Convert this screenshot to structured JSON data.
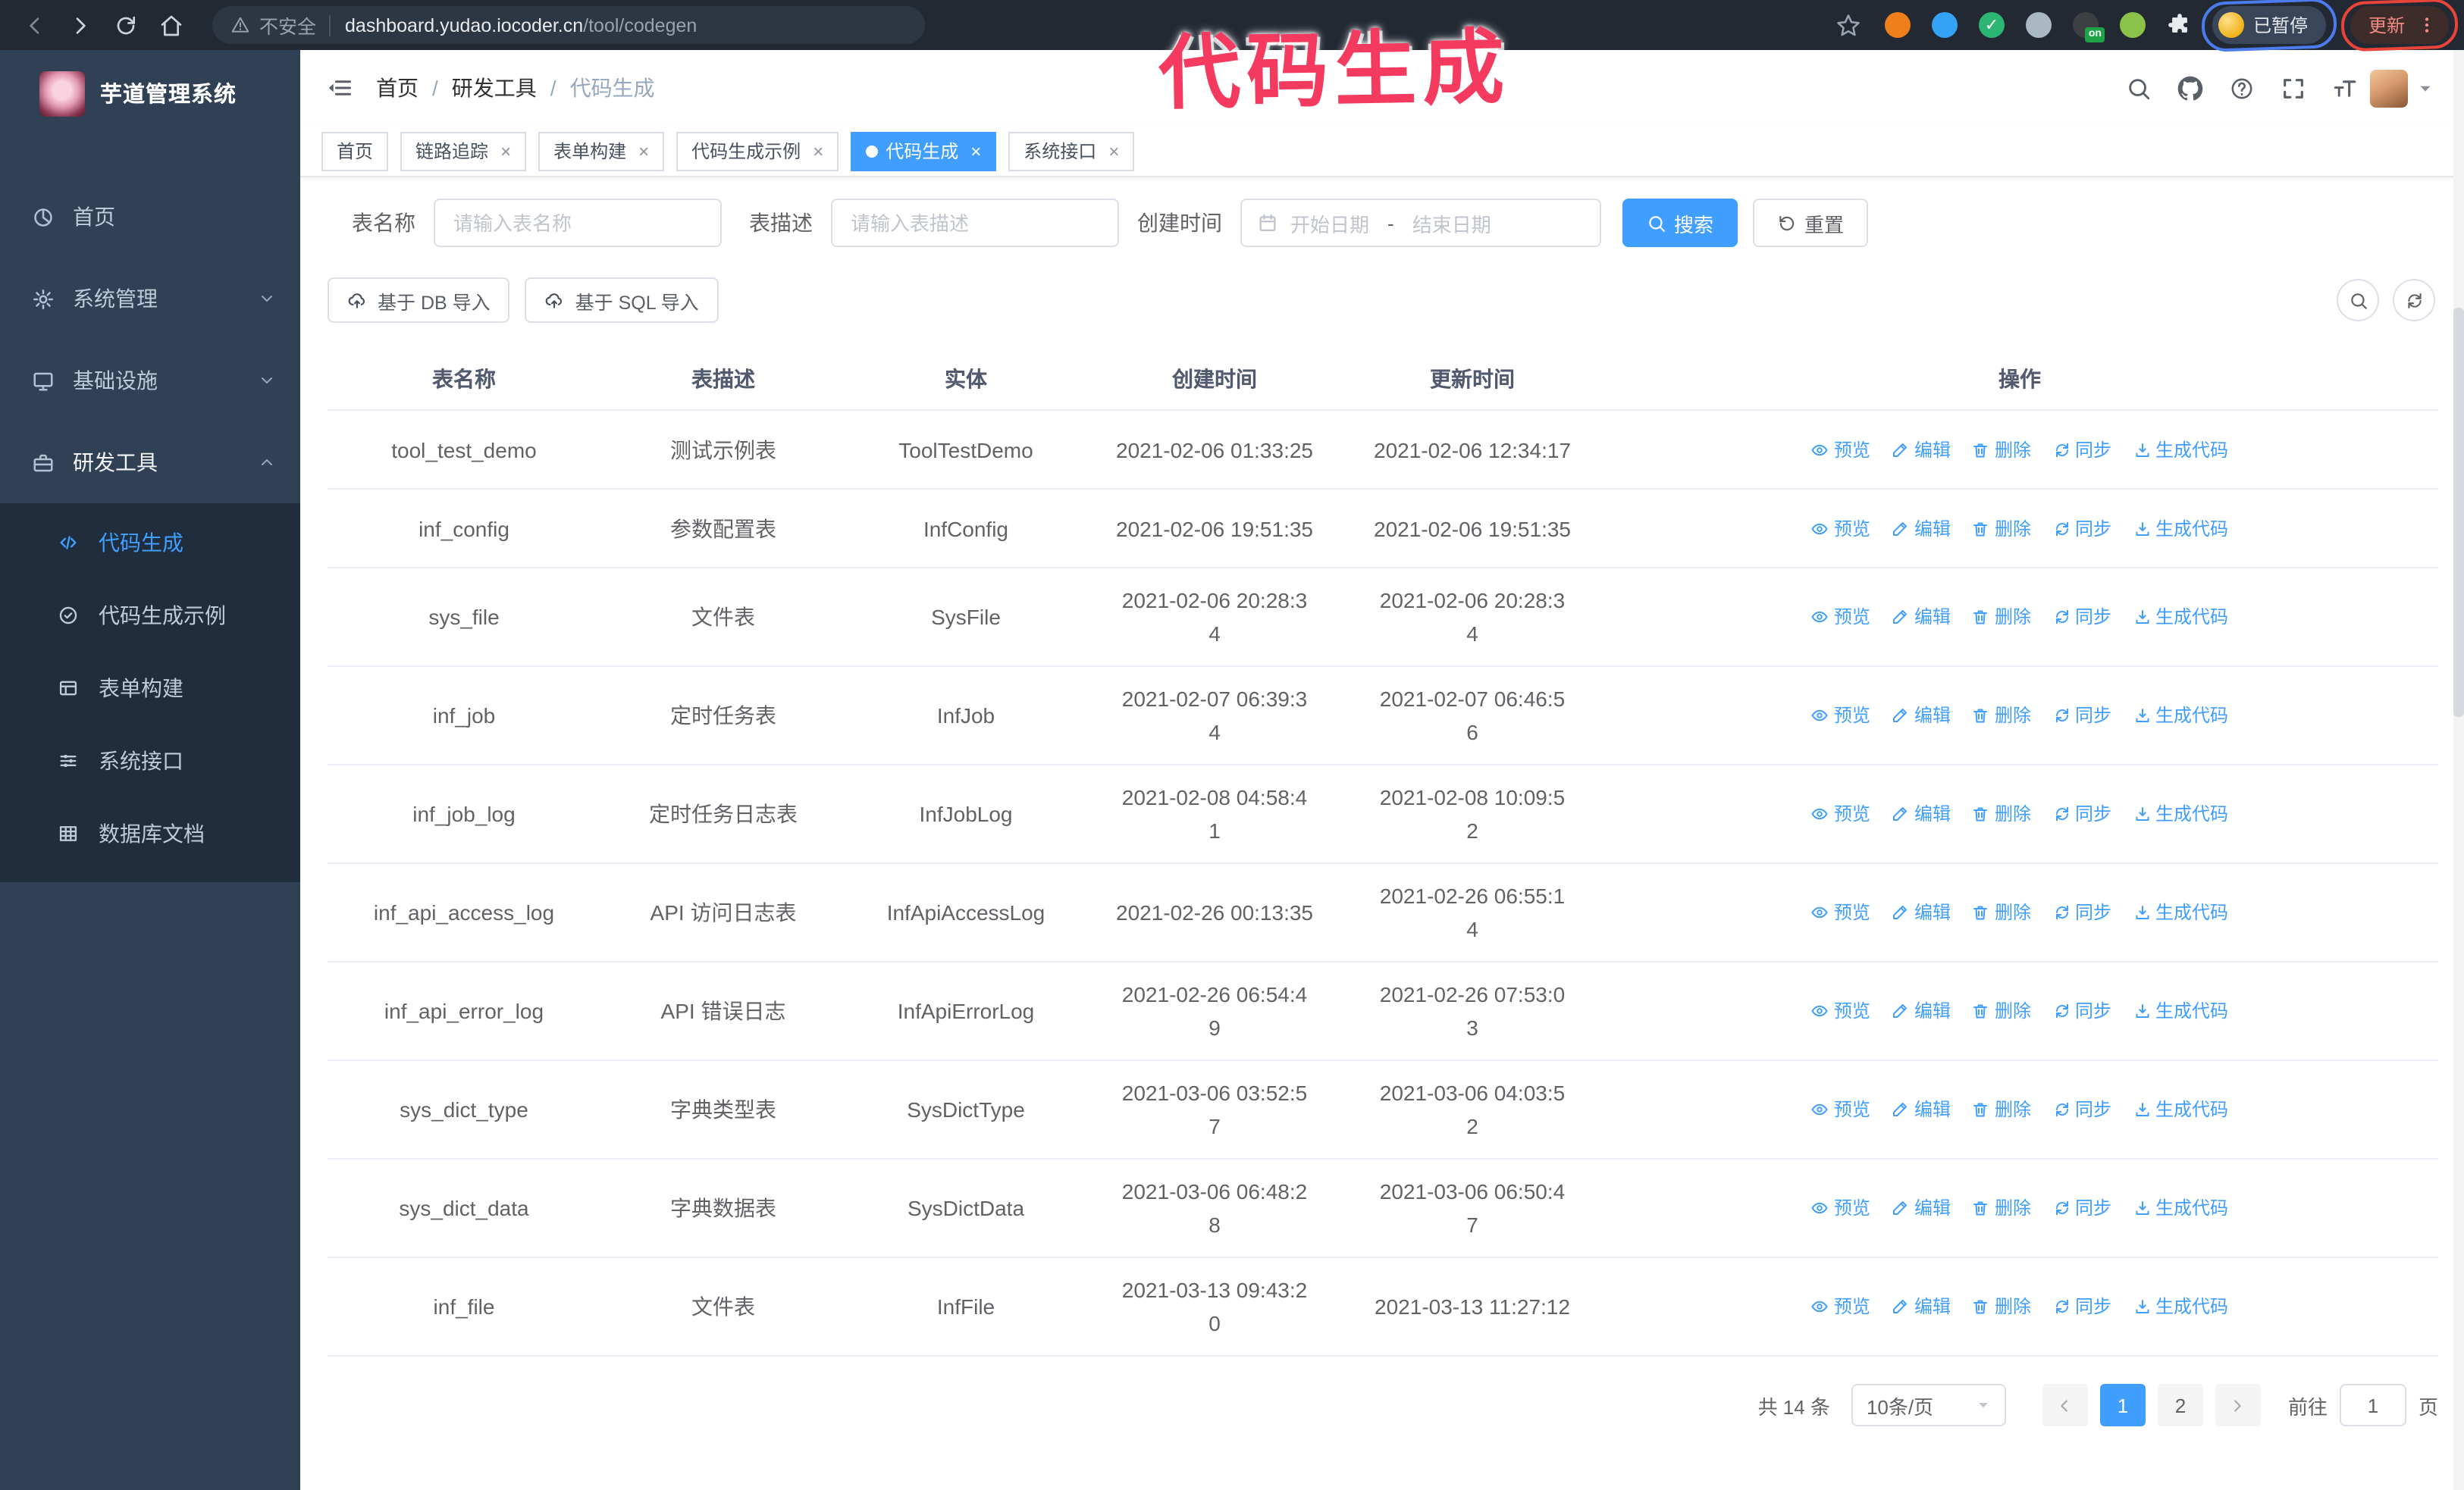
{
  "colors": {
    "primary": "#409eff",
    "sidebar_bg": "#304156",
    "submenu_bg": "#1f2d3d",
    "annotation_pink": "#f43a5e",
    "annotation_blue": "#4b7bec",
    "annotation_red": "#e8443a",
    "chrome_bg": "#232933"
  },
  "annotation": {
    "title": "代码生成"
  },
  "browser": {
    "security_label": "不安全",
    "url_host": "dashboard.yudao.iocoder.cn",
    "url_path": "/tool/codegen",
    "extensions": [
      {
        "name": "proxy-extension-icon",
        "color": "#ef7f1a"
      },
      {
        "name": "gem-extension-icon",
        "color": "#35a3f5"
      },
      {
        "name": "check-extension-icon",
        "color": "#2bb673",
        "check": "✓"
      },
      {
        "name": "grid-extension-icon",
        "color": "#aab8c4"
      },
      {
        "name": "switch-extension-icon",
        "color": "#3c4043",
        "badge": "on"
      },
      {
        "name": "animal-extension-icon",
        "color": "#8bc34a"
      },
      {
        "name": "puzzle-extension-icon",
        "color": "#e8eaed",
        "puzzle": true
      }
    ],
    "paused_label": "已暂停",
    "update_label": "更新"
  },
  "sidebar": {
    "app_title": "芋道管理系统",
    "menu": [
      {
        "slug": "home",
        "icon": "dashboard-icon",
        "label": "首页",
        "expandable": false,
        "open": false
      },
      {
        "slug": "system",
        "icon": "gear-icon",
        "label": "系统管理",
        "expandable": true,
        "open": false
      },
      {
        "slug": "infra",
        "icon": "monitor-icon",
        "label": "基础设施",
        "expandable": true,
        "open": false
      },
      {
        "slug": "dev-tools",
        "icon": "toolbox-icon",
        "label": "研发工具",
        "expandable": true,
        "open": true
      }
    ],
    "submenu": [
      {
        "slug": "codegen",
        "icon": "code-icon",
        "label": "代码生成",
        "active": true
      },
      {
        "slug": "codegen-example",
        "icon": "badge-check-icon",
        "label": "代码生成示例",
        "active": false
      },
      {
        "slug": "form-builder",
        "icon": "form-icon",
        "label": "表单构建",
        "active": false
      },
      {
        "slug": "system-api",
        "icon": "sliders-icon",
        "label": "系统接口",
        "active": false
      },
      {
        "slug": "db-doc",
        "icon": "database-icon",
        "label": "数据库文档",
        "active": false
      }
    ]
  },
  "header": {
    "breadcrumb": [
      "首页",
      "研发工具",
      "代码生成"
    ]
  },
  "tabs": [
    {
      "label": "首页",
      "closable": false,
      "active": false
    },
    {
      "label": "链路追踪",
      "closable": true,
      "active": false
    },
    {
      "label": "表单构建",
      "closable": true,
      "active": false
    },
    {
      "label": "代码生成示例",
      "closable": true,
      "active": false
    },
    {
      "label": "代码生成",
      "closable": true,
      "active": true
    },
    {
      "label": "系统接口",
      "closable": true,
      "active": false
    }
  ],
  "search": {
    "name_label": "表名称",
    "name_placeholder": "请输入表名称",
    "desc_label": "表描述",
    "desc_placeholder": "请输入表描述",
    "time_label": "创建时间",
    "start_placeholder": "开始日期",
    "range_separator": "-",
    "end_placeholder": "结束日期",
    "search_label": "搜索",
    "reset_label": "重置"
  },
  "toolbar": {
    "db_import_label": "基于 DB 导入",
    "sql_import_label": "基于 SQL 导入"
  },
  "table": {
    "columns": [
      "表名称",
      "表描述",
      "实体",
      "创建时间",
      "更新时间",
      "操作"
    ],
    "actions": [
      {
        "name": "preview-link",
        "icon": "eye-icon",
        "label": "预览"
      },
      {
        "name": "edit-link",
        "icon": "edit-icon",
        "label": "编辑"
      },
      {
        "name": "delete-link",
        "icon": "trash-icon",
        "label": "删除"
      },
      {
        "name": "sync-link",
        "icon": "sync-icon",
        "label": "同步"
      },
      {
        "name": "generate-code-link",
        "icon": "download-icon",
        "label": "生成代码"
      }
    ],
    "rows": [
      {
        "name": "tool_test_demo",
        "desc": "测试示例表",
        "entity": "ToolTestDemo",
        "created": "2021-02-06 01:33:25",
        "updated": "2021-02-06 12:34:17"
      },
      {
        "name": "inf_config",
        "desc": "参数配置表",
        "entity": "InfConfig",
        "created": "2021-02-06 19:51:35",
        "updated": "2021-02-06 19:51:35"
      },
      {
        "name": "sys_file",
        "desc": "文件表",
        "entity": "SysFile",
        "created": "2021-02-06 20:28:3\n4",
        "updated": "2021-02-06 20:28:3\n4"
      },
      {
        "name": "inf_job",
        "desc": "定时任务表",
        "entity": "InfJob",
        "created": "2021-02-07 06:39:3\n4",
        "updated": "2021-02-07 06:46:5\n6"
      },
      {
        "name": "inf_job_log",
        "desc": "定时任务日志表",
        "entity": "InfJobLog",
        "created": "2021-02-08 04:58:4\n1",
        "updated": "2021-02-08 10:09:5\n2"
      },
      {
        "name": "inf_api_access_log",
        "desc": "API 访问日志表",
        "entity": "InfApiAccessLog",
        "created": "2021-02-26 00:13:35",
        "updated": "2021-02-26 06:55:1\n4"
      },
      {
        "name": "inf_api_error_log",
        "desc": "API 错误日志",
        "entity": "InfApiErrorLog",
        "created": "2021-02-26 06:54:4\n9",
        "updated": "2021-02-26 07:53:0\n3"
      },
      {
        "name": "sys_dict_type",
        "desc": "字典类型表",
        "entity": "SysDictType",
        "created": "2021-03-06 03:52:5\n7",
        "updated": "2021-03-06 04:03:5\n2"
      },
      {
        "name": "sys_dict_data",
        "desc": "字典数据表",
        "entity": "SysDictData",
        "created": "2021-03-06 06:48:2\n8",
        "updated": "2021-03-06 06:50:4\n7"
      },
      {
        "name": "inf_file",
        "desc": "文件表",
        "entity": "InfFile",
        "created": "2021-03-13 09:43:2\n0",
        "updated": "2021-03-13 11:27:12"
      }
    ]
  },
  "pagination": {
    "total": "共 14 条",
    "page_size": "10条/页",
    "pages": [
      "1",
      "2"
    ],
    "active_page": "1",
    "goto_label": "前往",
    "goto_value": "1",
    "unit_label": "页"
  }
}
